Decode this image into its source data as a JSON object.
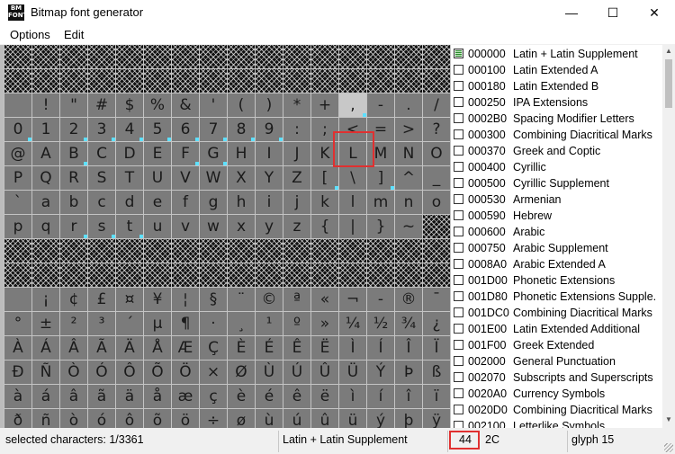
{
  "window": {
    "icon_text": [
      "BM",
      "FONT"
    ],
    "title": "Bitmap font generator",
    "minimize_glyph": "—",
    "maximize_glyph": "☐",
    "close_glyph": "✕"
  },
  "menu": [
    "Options",
    "Edit"
  ],
  "grid": {
    "columns": 16,
    "rows": [
      {
        "gap": true
      },
      {
        "gap": true
      },
      {
        "chars": [
          "",
          "!",
          "\"",
          "#",
          "$",
          "%",
          "&",
          "'",
          "(",
          ")",
          "*",
          "+",
          ",",
          "-",
          ".",
          "/"
        ]
      },
      {
        "chars": [
          "0",
          "1",
          "2",
          "3",
          "4",
          "5",
          "6",
          "7",
          "8",
          "9",
          ":",
          ";",
          "<",
          "=",
          ">",
          "?"
        ]
      },
      {
        "chars": [
          "@",
          "A",
          "B",
          "C",
          "D",
          "E",
          "F",
          "G",
          "H",
          "I",
          "J",
          "K",
          "L",
          "M",
          "N",
          "O"
        ]
      },
      {
        "chars": [
          "P",
          "Q",
          "R",
          "S",
          "T",
          "U",
          "V",
          "W",
          "X",
          "Y",
          "Z",
          "[",
          "\\",
          "]",
          "^",
          "_"
        ]
      },
      {
        "chars": [
          "`",
          "a",
          "b",
          "c",
          "d",
          "e",
          "f",
          "g",
          "h",
          "i",
          "j",
          "k",
          "l",
          "m",
          "n",
          "o"
        ]
      },
      {
        "chars": [
          "p",
          "q",
          "r",
          "s",
          "t",
          "u",
          "v",
          "w",
          "x",
          "y",
          "z",
          "{",
          "|",
          "}",
          "~",
          null
        ]
      },
      {
        "gap": true
      },
      {
        "gap": true
      },
      {
        "chars": [
          "",
          "¡",
          "¢",
          "£",
          "¤",
          "¥",
          "¦",
          "§",
          "¨",
          "©",
          "ª",
          "«",
          "¬",
          "-",
          "®",
          "¯"
        ]
      },
      {
        "chars": [
          "°",
          "±",
          "²",
          "³",
          "´",
          "µ",
          "¶",
          "·",
          "¸",
          "¹",
          "º",
          "»",
          "¼",
          "½",
          "¾",
          "¿"
        ]
      },
      {
        "chars": [
          "À",
          "Á",
          "Â",
          "Ã",
          "Ä",
          "Å",
          "Æ",
          "Ç",
          "È",
          "É",
          "Ê",
          "Ë",
          "Ì",
          "Í",
          "Î",
          "Ï"
        ]
      },
      {
        "chars": [
          "Ð",
          "Ñ",
          "Ò",
          "Ó",
          "Ô",
          "Õ",
          "Ö",
          "×",
          "Ø",
          "Ù",
          "Ú",
          "Û",
          "Ü",
          "Ý",
          "Þ",
          "ß"
        ]
      },
      {
        "chars": [
          "à",
          "á",
          "â",
          "ã",
          "ä",
          "å",
          "æ",
          "ç",
          "è",
          "é",
          "ê",
          "ë",
          "ì",
          "í",
          "î",
          "ï"
        ]
      },
      {
        "chars": [
          "ð",
          "ñ",
          "ò",
          "ó",
          "ô",
          "õ",
          "ö",
          "÷",
          "ø",
          "ù",
          "ú",
          "û",
          "ü",
          "ý",
          "þ",
          "ÿ"
        ]
      }
    ],
    "selected": {
      "row": 2,
      "col": 12
    },
    "marked": [
      [
        2,
        12
      ],
      [
        3,
        0
      ],
      [
        3,
        2
      ],
      [
        3,
        3
      ],
      [
        3,
        4
      ],
      [
        3,
        5
      ],
      [
        3,
        6
      ],
      [
        3,
        7
      ],
      [
        3,
        8
      ],
      [
        3,
        9
      ],
      [
        4,
        2
      ],
      [
        4,
        6
      ],
      [
        4,
        7
      ],
      [
        5,
        11
      ],
      [
        5,
        13
      ],
      [
        7,
        2
      ],
      [
        7,
        3
      ],
      [
        7,
        4
      ]
    ],
    "mark_color": "#5de0ff",
    "highlight_color": "#e03030"
  },
  "ranges": [
    {
      "code": "000000",
      "name": "Latin + Latin Supplement",
      "checked": true
    },
    {
      "code": "000100",
      "name": "Latin Extended A",
      "checked": false
    },
    {
      "code": "000180",
      "name": "Latin Extended B",
      "checked": false
    },
    {
      "code": "000250",
      "name": "IPA Extensions",
      "checked": false
    },
    {
      "code": "0002B0",
      "name": "Spacing Modifier Letters",
      "checked": false
    },
    {
      "code": "000300",
      "name": "Combining Diacritical Marks",
      "checked": false
    },
    {
      "code": "000370",
      "name": "Greek and Coptic",
      "checked": false
    },
    {
      "code": "000400",
      "name": "Cyrillic",
      "checked": false
    },
    {
      "code": "000500",
      "name": "Cyrillic Supplement",
      "checked": false
    },
    {
      "code": "000530",
      "name": "Armenian",
      "checked": false
    },
    {
      "code": "000590",
      "name": "Hebrew",
      "checked": false
    },
    {
      "code": "000600",
      "name": "Arabic",
      "checked": false
    },
    {
      "code": "000750",
      "name": "Arabic Supplement",
      "checked": false
    },
    {
      "code": "0008A0",
      "name": "Arabic Extended A",
      "checked": false
    },
    {
      "code": "001D00",
      "name": "Phonetic Extensions",
      "checked": false
    },
    {
      "code": "001D80",
      "name": "Phonetic Extensions Supple.",
      "checked": false
    },
    {
      "code": "001DC0",
      "name": "Combining Diacritical Marks",
      "checked": false
    },
    {
      "code": "001E00",
      "name": "Latin Extended Additional",
      "checked": false
    },
    {
      "code": "001F00",
      "name": "Greek Extended",
      "checked": false
    },
    {
      "code": "002000",
      "name": "General Punctuation",
      "checked": false
    },
    {
      "code": "002070",
      "name": "Subscripts and Superscripts",
      "checked": false
    },
    {
      "code": "0020A0",
      "name": "Currency Symbols",
      "checked": false
    },
    {
      "code": "0020D0",
      "name": "Combining Diacritical Marks",
      "checked": false
    },
    {
      "code": "002100",
      "name": "Letterlike Symbols",
      "checked": false
    }
  ],
  "scrollbar": {
    "up_glyph": "▲",
    "down_glyph": "▼"
  },
  "status": {
    "selected": "selected characters: 1/3361",
    "range": "Latin + Latin Supplement",
    "decimal": "44",
    "hex": "2C",
    "glyph": "glyph 15"
  }
}
